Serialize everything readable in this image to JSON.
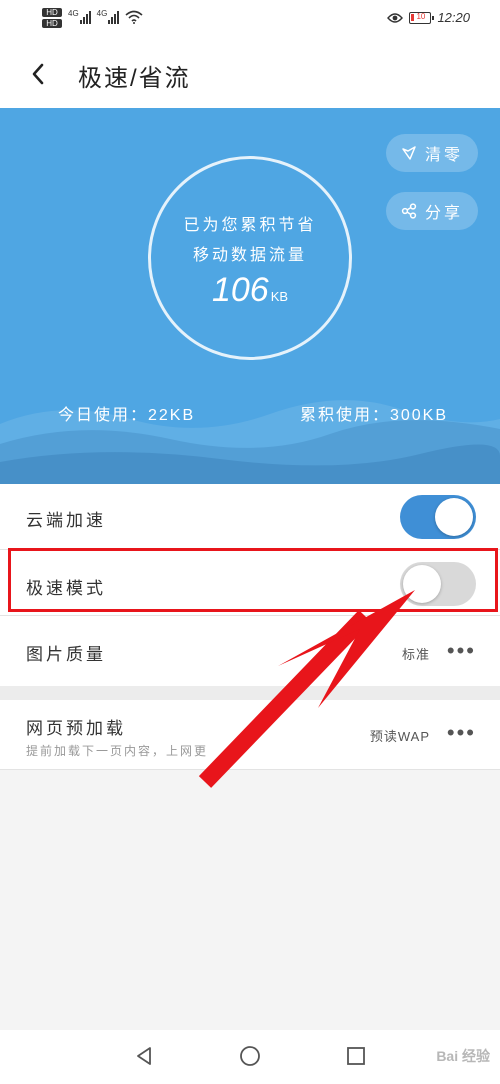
{
  "status_bar": {
    "hd_badges": [
      "HD",
      "HD"
    ],
    "network_labels": [
      "4G",
      "4G"
    ],
    "battery_level": "10",
    "time": "12:20"
  },
  "header": {
    "title": "极速/省流",
    "back_icon": "chevron-left-icon"
  },
  "hero": {
    "saved_line1": "已为您累积节省",
    "saved_line2": "移动数据流量",
    "saved_value": "106",
    "saved_unit": "KB",
    "clear_label": "清零",
    "clear_icon": "broom-icon",
    "share_label": "分享",
    "share_icon": "share-icon",
    "today_usage": "今日使用：22KB",
    "total_usage": "累积使用：300KB",
    "background_color": "#4fa6e3"
  },
  "settings": {
    "cloud_speedup": {
      "label": "云端加速",
      "enabled": true
    },
    "fast_mode": {
      "label": "极速模式",
      "enabled": false
    },
    "image_quality": {
      "label": "图片质量",
      "value": "标准"
    },
    "page_preload": {
      "label": "网页预加载",
      "subtitle": "提前加载下一页内容，上网更",
      "value": "预读WAP"
    }
  },
  "nav_bar": {
    "back_icon": "triangle-back-icon",
    "home_icon": "circle-home-icon",
    "recents_icon": "square-recents-icon",
    "watermark": "Bai 经验"
  },
  "annotation": {
    "highlight_color": "#e8151b"
  }
}
